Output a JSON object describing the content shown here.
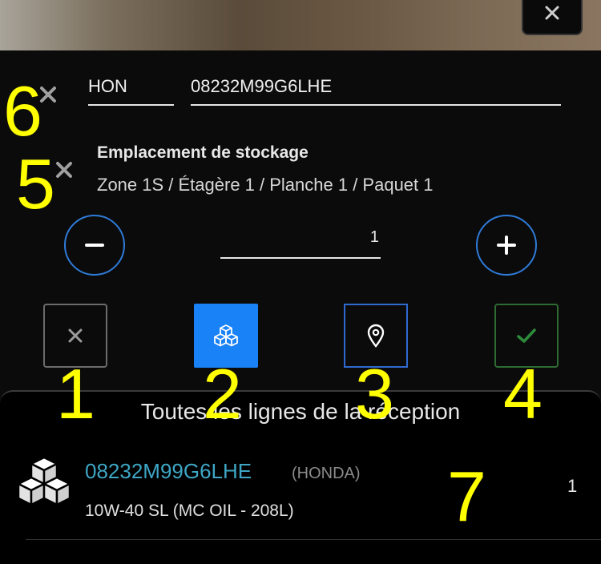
{
  "header": {
    "close_icon": "close-icon"
  },
  "part_form": {
    "brand_value": "HON",
    "reference_value": "08232M99G6LHE",
    "clear_icon": "close-icon"
  },
  "storage": {
    "title": "Emplacement de stockage",
    "path": "Zone 1S / Étagère 1 / Planche 1 / Paquet 1",
    "clear_icon": "close-icon"
  },
  "quantity": {
    "value": "1",
    "decrement_icon": "minus-icon",
    "increment_icon": "plus-icon"
  },
  "actions": [
    {
      "name": "cancel",
      "icon": "close-icon"
    },
    {
      "name": "product",
      "icon": "cubes-icon",
      "active": true
    },
    {
      "name": "location",
      "icon": "map-pin-icon"
    },
    {
      "name": "confirm",
      "icon": "check-icon"
    }
  ],
  "annotations": [
    "1",
    "2",
    "3",
    "4",
    "5",
    "6",
    "7"
  ],
  "reception": {
    "title": "Toutes les lignes de la réception",
    "items": [
      {
        "reference": "08232M99G6LHE",
        "brand": "(HONDA)",
        "description": "10W-40 SL (MC OIL - 208L)",
        "quantity": "1"
      }
    ]
  },
  "colors": {
    "accent": "#2f7bd8",
    "active_bg": "#1a82f7",
    "success": "#2e8b3a",
    "link": "#3ea6c4",
    "annotation": "#ffff00"
  }
}
